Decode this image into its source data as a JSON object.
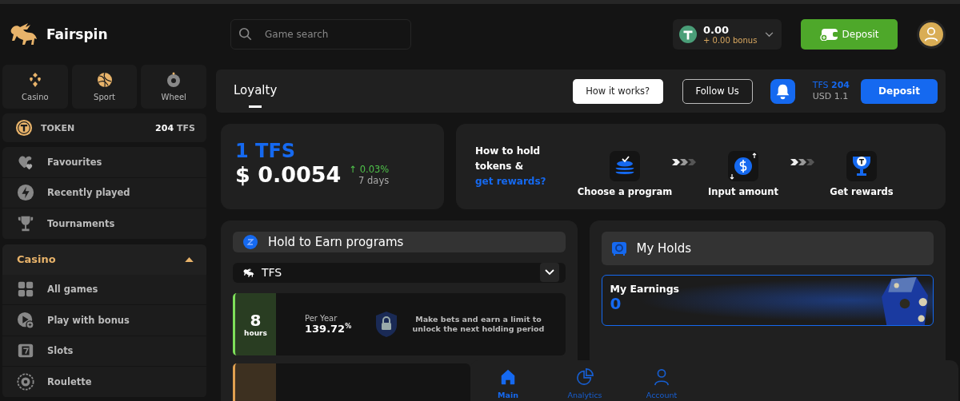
{
  "brand": "Fairspin",
  "search": {
    "placeholder": "Game search"
  },
  "balance": {
    "amount": "0.00",
    "bonus": "+ 0.00 bonus"
  },
  "header_deposit": "Deposit",
  "quick_tiles": [
    {
      "label": "Casino",
      "kind": "cards"
    },
    {
      "label": "Sport",
      "kind": "ball"
    },
    {
      "label": "Wheel",
      "kind": "wheel"
    }
  ],
  "token": {
    "label": "TOKEN",
    "amount": "204",
    "unit": "TFS"
  },
  "sidebar_items": [
    {
      "label": "Favourites",
      "kind": "heart"
    },
    {
      "label": "Recently played",
      "kind": "bolt"
    },
    {
      "label": "Tournaments",
      "kind": "trophy"
    }
  ],
  "casino_section": {
    "title": "Casino",
    "expanded": true,
    "items": [
      {
        "label": "All games",
        "kind": "grid"
      },
      {
        "label": "Play with bonus",
        "kind": "play"
      },
      {
        "label": "Slots",
        "kind": "slot"
      },
      {
        "label": "Roulette",
        "kind": "roulette"
      }
    ]
  },
  "tabs": [
    {
      "label": "Loyalty",
      "selected": true
    }
  ],
  "toolbar": {
    "how_it_works": "How it works?",
    "follow": "Follow Us",
    "tfs_label": "TFS",
    "tfs_amount": "204",
    "usd": "USD 1.1",
    "deposit": "Deposit"
  },
  "price": {
    "title": "1 TFS",
    "value": "$ 0.0054",
    "change": "↑ 0.03%",
    "period": "7 days"
  },
  "how_to": {
    "text": "How to hold tokens & ",
    "link": "get rewards?",
    "steps": [
      {
        "label": "Choose a program",
        "kind": "coins"
      },
      {
        "label": "Input amount",
        "kind": "dollar"
      },
      {
        "label": "Get rewards",
        "kind": "cup"
      }
    ]
  },
  "programs": {
    "title": "Hold to Earn programs",
    "token": "TFS",
    "cards": [
      {
        "number": "8",
        "unit": "hours",
        "per_year_label": "Per Year",
        "rate": "139.72",
        "rate_unit": "%",
        "note": "Make bets and earn a limit to unlock the next holding period",
        "color": "#7ee05a"
      },
      {
        "color": "#e0a050"
      }
    ]
  },
  "holds": {
    "title": "My Holds",
    "earnings_label": "My Earnings",
    "earnings": "0"
  },
  "bottom_nav": [
    {
      "label": "Main",
      "kind": "home",
      "selected": true
    },
    {
      "label": "Analytics",
      "kind": "pie",
      "selected": false
    },
    {
      "label": "Account",
      "kind": "user",
      "selected": false
    }
  ]
}
